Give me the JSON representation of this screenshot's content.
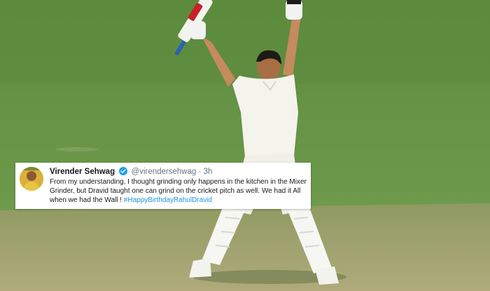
{
  "colors": {
    "grass": "#5f8f41",
    "pitch": "#a8a472",
    "link": "#1b95e0",
    "verified": "#1da1f2"
  },
  "tweet": {
    "author_name": "Virender Sehwag",
    "verified_icon": "verified-badge-icon",
    "handle": "@virendersehwag",
    "separator": "·",
    "time": "3h",
    "text": "From my understanding, I thought grinding only happens in the kitchen in the Mixer Grinder, but Dravid taught one can grind on the cricket pitch as well. We had it All when we had the Wall ! ",
    "hashtag": "#HappyBirthdayRahulDravid"
  }
}
